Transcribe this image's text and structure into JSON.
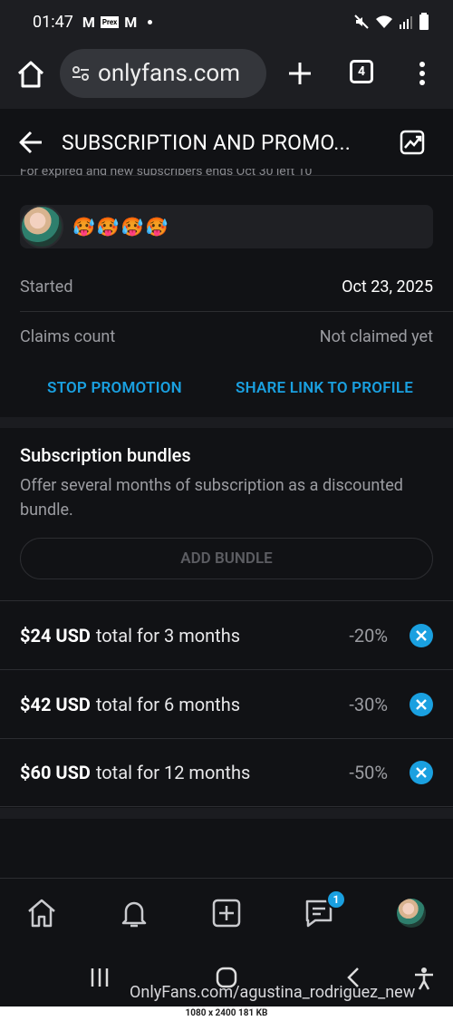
{
  "status_bar": {
    "time": "01:47",
    "notif_label": "Prex"
  },
  "browser": {
    "url": "onlyfans.com",
    "tab_count": "4"
  },
  "header": {
    "title": "SUBSCRIPTION AND PROMO..."
  },
  "promo": {
    "cut_text": "For expired and new subscribers    ends Oct 30    left 10",
    "emoji": "🥵🥵🥵🥵"
  },
  "details": [
    {
      "label": "Started",
      "value": "Oct 23, 2025"
    },
    {
      "label": "Claims count",
      "value": "Not claimed yet"
    }
  ],
  "actions": {
    "stop": "STOP PROMOTION",
    "share": "SHARE LINK TO PROFILE"
  },
  "bundles": {
    "title": "Subscription bundles",
    "description": "Offer several months of subscription as a discounted bundle.",
    "add_label": "ADD BUNDLE",
    "items": [
      {
        "price": "$24 USD",
        "text": "total for 3 months",
        "discount": "-20%"
      },
      {
        "price": "$42 USD",
        "text": "total for 6 months",
        "discount": "-30%"
      },
      {
        "price": "$60 USD",
        "text": "total for 12 months",
        "discount": "-50%"
      }
    ]
  },
  "bottom_nav": {
    "messages_badge": "1"
  },
  "watermark": "OnlyFans.com/agustina_rodriguez_new",
  "footer_info": "1080 x 2400 181 KB",
  "colors": {
    "accent": "#1aa0e0",
    "background": "#111215",
    "card": "#1f2024"
  }
}
